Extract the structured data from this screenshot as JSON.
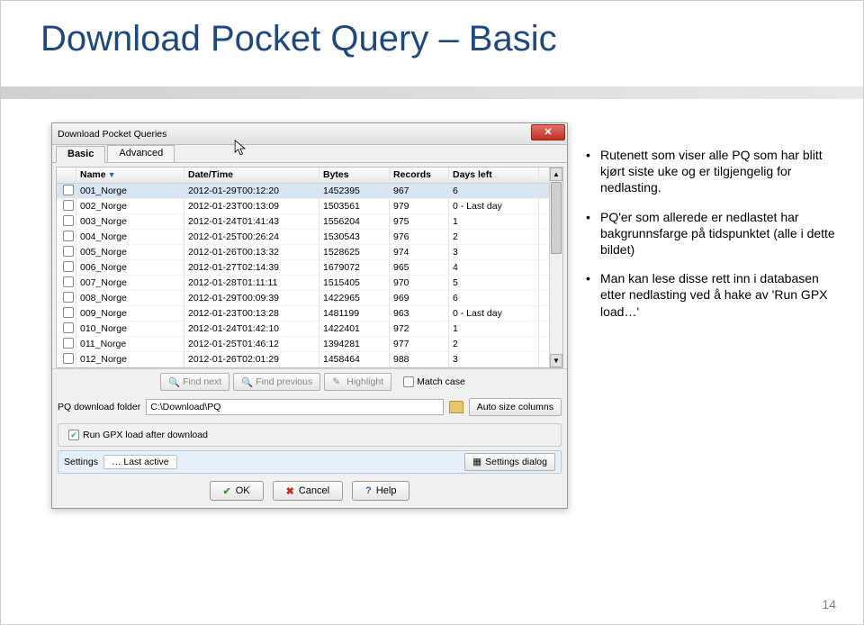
{
  "slide": {
    "title": "Download Pocket Query – Basic",
    "page_number": "14"
  },
  "bullets": [
    "Rutenett som viser alle PQ som har blitt kjørt siste uke og er tilgjengelig for nedlasting.",
    "PQ'er som allerede er nedlastet har bakgrunnsfarge på tidspunktet (alle i dette bildet)",
    "Man kan lese disse rett inn i databasen etter nedlasting ved å hake av 'Run GPX load…'"
  ],
  "dialog": {
    "title": "Download Pocket Queries",
    "tabs": {
      "basic": "Basic",
      "advanced": "Advanced"
    },
    "columns": {
      "name": "Name",
      "datetime": "Date/Time",
      "bytes": "Bytes",
      "records": "Records",
      "daysleft": "Days left"
    },
    "rows": [
      {
        "name": "001_Norge",
        "dt": "2012-01-29T00:12:20",
        "bytes": "1452395",
        "rec": "967",
        "days": "6",
        "sel": true
      },
      {
        "name": "002_Norge",
        "dt": "2012-01-23T00:13:09",
        "bytes": "1503561",
        "rec": "979",
        "days": "0 - Last day"
      },
      {
        "name": "003_Norge",
        "dt": "2012-01-24T01:41:43",
        "bytes": "1556204",
        "rec": "975",
        "days": "1"
      },
      {
        "name": "004_Norge",
        "dt": "2012-01-25T00:26:24",
        "bytes": "1530543",
        "rec": "976",
        "days": "2"
      },
      {
        "name": "005_Norge",
        "dt": "2012-01-26T00:13:32",
        "bytes": "1528625",
        "rec": "974",
        "days": "3"
      },
      {
        "name": "006_Norge",
        "dt": "2012-01-27T02:14:39",
        "bytes": "1679072",
        "rec": "965",
        "days": "4"
      },
      {
        "name": "007_Norge",
        "dt": "2012-01-28T01:11:11",
        "bytes": "1515405",
        "rec": "970",
        "days": "5"
      },
      {
        "name": "008_Norge",
        "dt": "2012-01-29T00:09:39",
        "bytes": "1422965",
        "rec": "969",
        "days": "6"
      },
      {
        "name": "009_Norge",
        "dt": "2012-01-23T00:13:28",
        "bytes": "1481199",
        "rec": "963",
        "days": "0 - Last day"
      },
      {
        "name": "010_Norge",
        "dt": "2012-01-24T01:42:10",
        "bytes": "1422401",
        "rec": "972",
        "days": "1"
      },
      {
        "name": "011_Norge",
        "dt": "2012-01-25T01:46:12",
        "bytes": "1394281",
        "rec": "977",
        "days": "2"
      },
      {
        "name": "012_Norge",
        "dt": "2012-01-26T02:01:29",
        "bytes": "1458464",
        "rec": "988",
        "days": "3"
      }
    ],
    "findbar": {
      "find_next": "Find next",
      "find_previous": "Find previous",
      "highlight": "Highlight",
      "match_case": "Match case"
    },
    "pqfolder": {
      "label": "PQ download folder",
      "value": "C:\\Download\\PQ",
      "autosize": "Auto size columns"
    },
    "run_gpx": "Run GPX load after download",
    "settings_label": "Settings",
    "last_active": "… Last active",
    "settings_dialog": "Settings dialog",
    "buttons": {
      "ok": "OK",
      "cancel": "Cancel",
      "help": "Help"
    }
  }
}
